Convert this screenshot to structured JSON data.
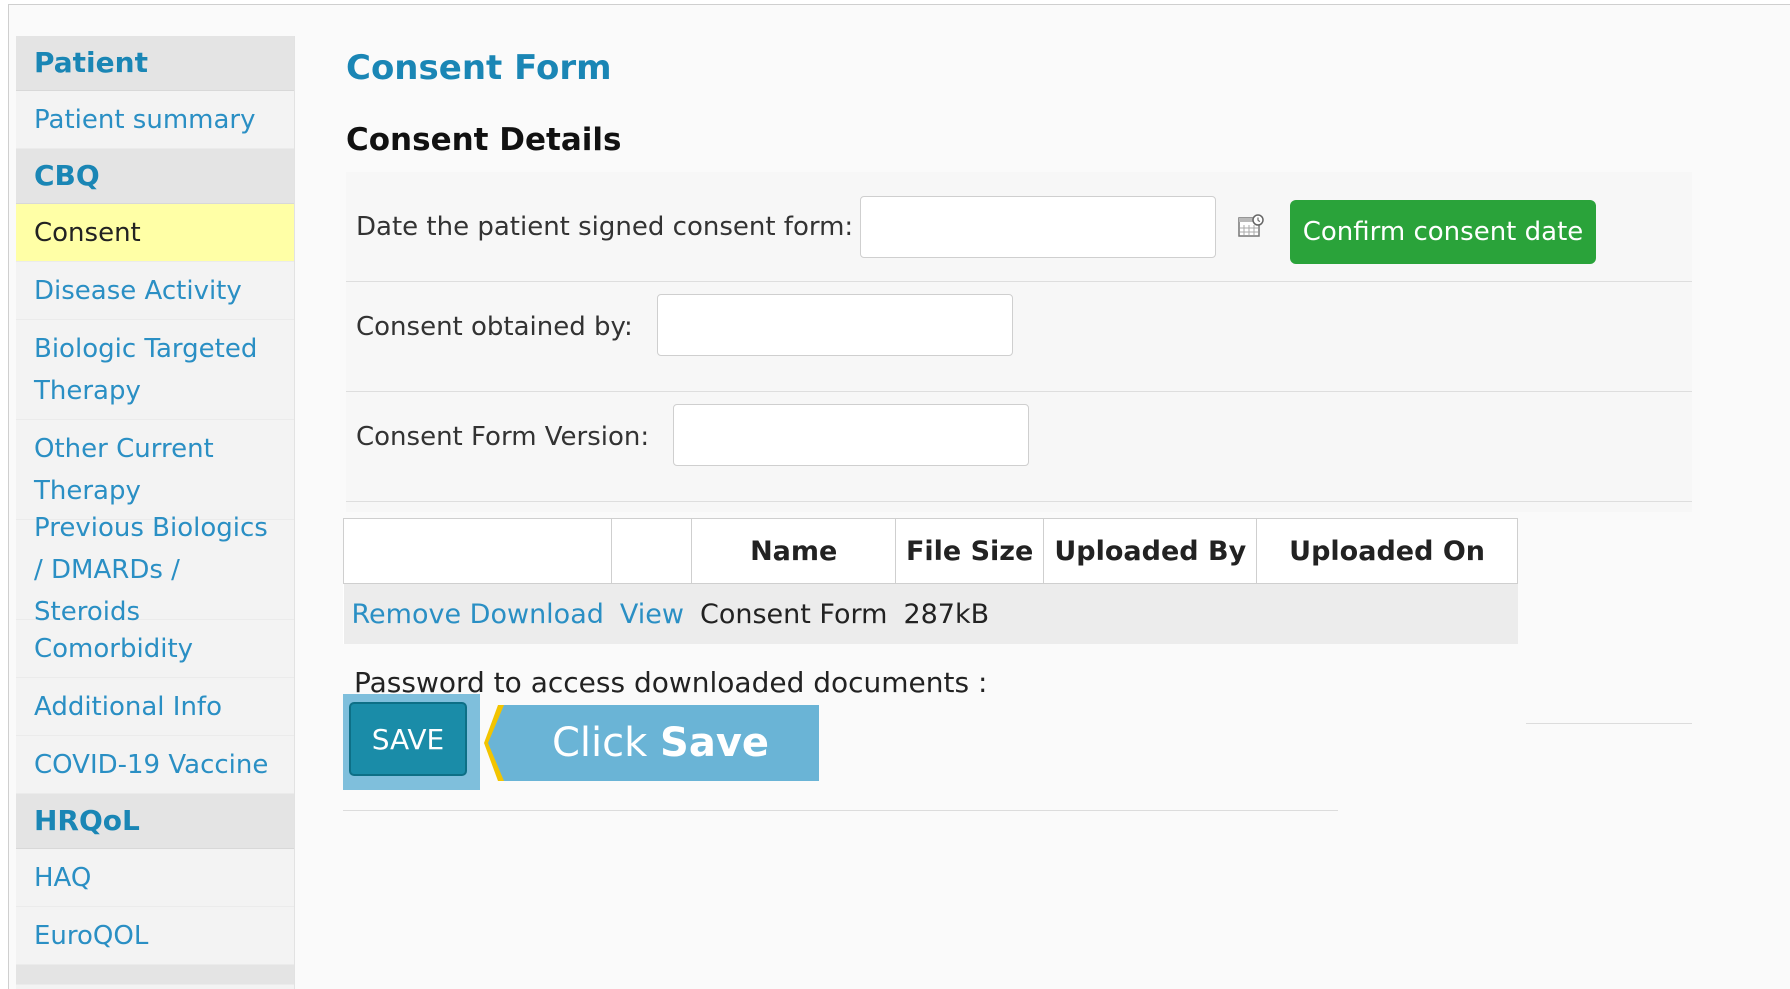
{
  "sidebar": {
    "sections": [
      {
        "header": "Patient",
        "items": [
          "Patient summary"
        ]
      },
      {
        "header": "CBQ",
        "items": [
          "Consent",
          "Disease Activity",
          "Biologic Targeted Therapy",
          "Other Current Therapy",
          "Previous Biologics / DMARDs / Steroids",
          "Comorbidity",
          "Additional Info",
          "COVID-19 Vaccine"
        ]
      },
      {
        "header": "HRQoL",
        "items": [
          "HAQ",
          "EuroQOL"
        ]
      }
    ],
    "active_item": "Consent"
  },
  "page": {
    "title": "Consent Form",
    "section_title": "Consent Details"
  },
  "form": {
    "consent_date_label": "Date the patient signed consent form:",
    "consent_date_value": "",
    "confirm_button": "Confirm consent date",
    "obtained_by_label": "Consent obtained by:",
    "obtained_by_value": "",
    "version_label": "Consent Form Version:",
    "version_value": ""
  },
  "documents": {
    "headers": [
      "",
      "",
      "Name",
      "File Size",
      "Uploaded By",
      "Uploaded On"
    ],
    "rows": [
      {
        "remove": "Remove",
        "download": "Download",
        "view": "View",
        "name": "Consent Form",
        "size": "287kB",
        "uploaded_by": "",
        "uploaded_on": ""
      }
    ]
  },
  "password_label": "Password to access downloaded documents :",
  "save_button": "SAVE",
  "callout": {
    "prefix": "Click",
    "emphasis": "Save"
  },
  "icons": [
    "calendar-icon"
  ],
  "colors": {
    "accent": "#1a86b5",
    "link": "#2a8fc4",
    "confirm": "#2aa33a",
    "save": "#1a8ca8",
    "highlight": "#ffffa6",
    "callout": "#6ab4d6"
  }
}
